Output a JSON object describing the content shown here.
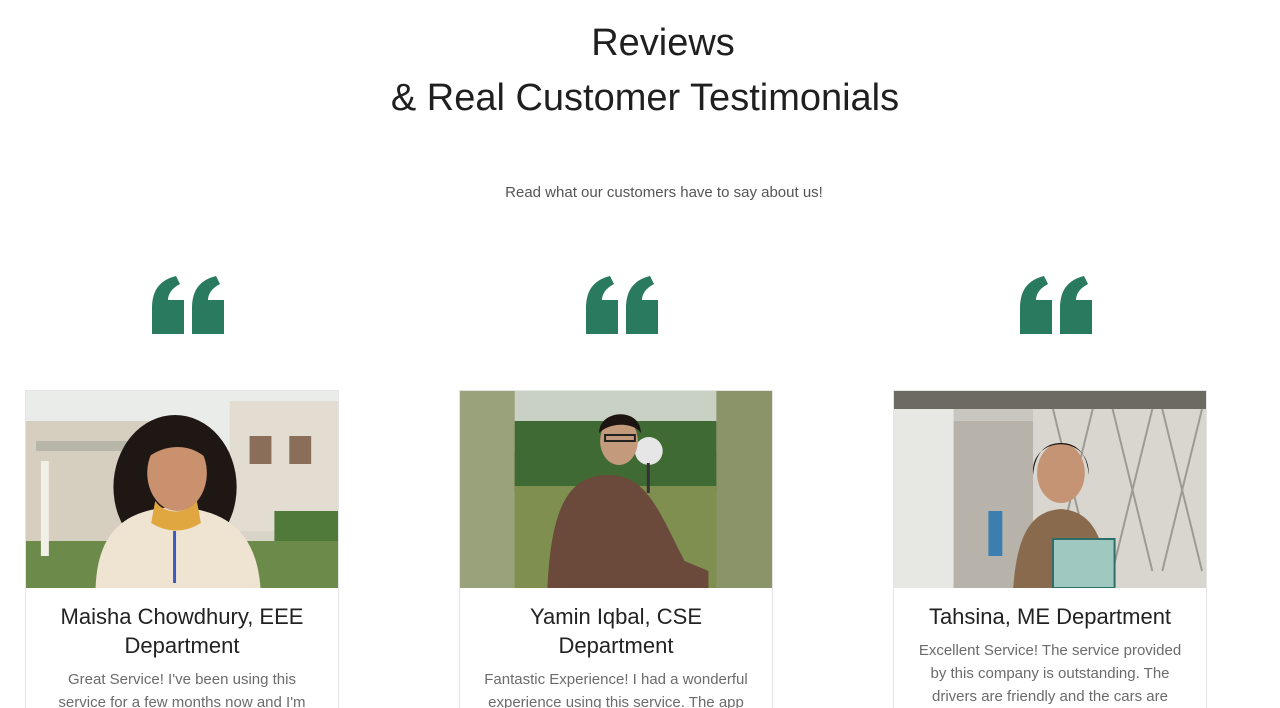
{
  "header": {
    "title_line1": "Reviews",
    "title_line2": "& Real Customer Testimonials",
    "subtitle": "Read what our customers have to say about us!"
  },
  "accent_color": "#2a7a5f",
  "testimonials": [
    {
      "icon": "quote-icon",
      "name": "Maisha Chowdhury, EEE Department",
      "review": "Great Service! I've been using this service for a few months now and I'm"
    },
    {
      "icon": "quote-icon",
      "name": "Yamin Iqbal, CSE Department",
      "review": "Fantastic Experience! I had a wonderful experience using this service. The app is"
    },
    {
      "icon": "quote-icon",
      "name": "Tahsina, ME Department",
      "review": "Excellent Service! The service provided by this company is outstanding. The drivers are friendly and the cars are"
    }
  ]
}
